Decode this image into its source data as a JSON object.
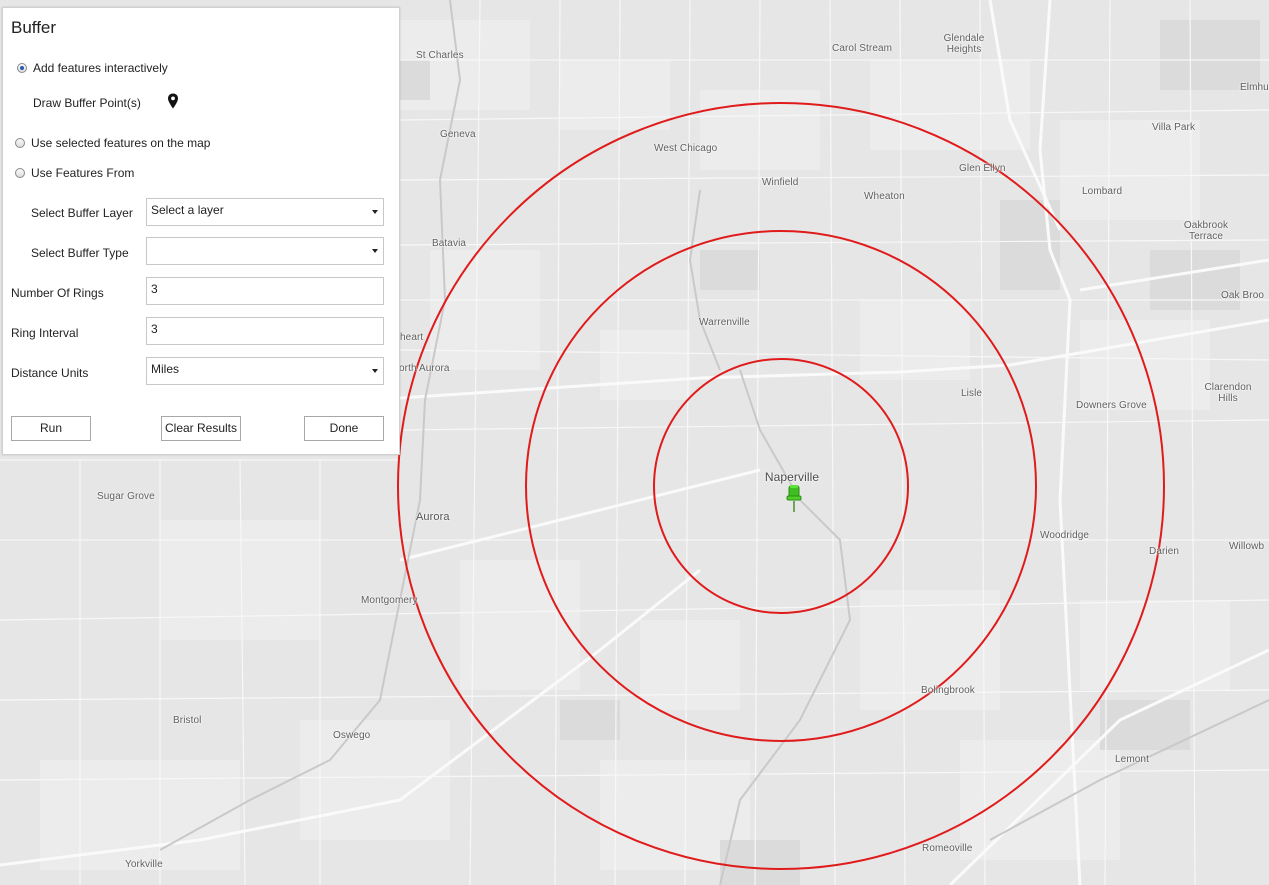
{
  "panel": {
    "title": "Buffer",
    "mode_options": [
      {
        "label": "Add features interactively",
        "checked": true
      },
      {
        "label": "Use selected features on the map",
        "checked": false
      },
      {
        "label": "Use Features From",
        "checked": false
      }
    ],
    "draw_label": "Draw Buffer Point(s)",
    "draw_icon": "map-pin-icon",
    "fields": {
      "layer": {
        "label": "Select Buffer Layer",
        "value": "Select a layer"
      },
      "type": {
        "label": "Select Buffer Type",
        "value": ""
      },
      "rings": {
        "label": "Number Of Rings",
        "value": "3"
      },
      "interval": {
        "label": "Ring Interval",
        "value": "3"
      },
      "units": {
        "label": "Distance Units",
        "value": "Miles"
      }
    },
    "buttons": {
      "run": "Run",
      "clear": "Clear Results",
      "done": "Done"
    }
  },
  "map": {
    "ring_color": "#e01b1b",
    "marker_color": "#3fbf1f",
    "marker_icon": "pushpin-icon",
    "center_place": "Naperville",
    "places": {
      "st_charles": "St Charles",
      "carol_stream": "Carol Stream",
      "glendale_heights": "Glendale Heights",
      "elmhurst": "Elmhu",
      "villa_park": "Villa Park",
      "geneva": "Geneva",
      "west_chicago": "West Chicago",
      "glen_ellyn": "Glen Ellyn",
      "winfield": "Winfield",
      "wheaton": "Wheaton",
      "lombard": "Lombard",
      "oakbrook_terrace": "Oakbrook Terrace",
      "batavia": "Batavia",
      "oak_brook": "Oak Broo",
      "warrenville": "Warrenville",
      "north_aurora_a": "heart",
      "north_aurora_b": "orth Aurora",
      "lisle": "Lisle",
      "clarendon_hills": "Clarendon Hills",
      "downers_grove": "Downers Grove",
      "sugar_grove": "Sugar Grove",
      "aurora": "Aurora",
      "woodridge": "Woodridge",
      "darien": "Darien",
      "willowbrook": "Willowb",
      "montgomery": "Montgomery",
      "bolingbrook": "Bolingbrook",
      "bristol": "Bristol",
      "oswego": "Oswego",
      "lemont": "Lemont",
      "yorkville": "Yorkville",
      "romeoville": "Romeoville"
    }
  }
}
